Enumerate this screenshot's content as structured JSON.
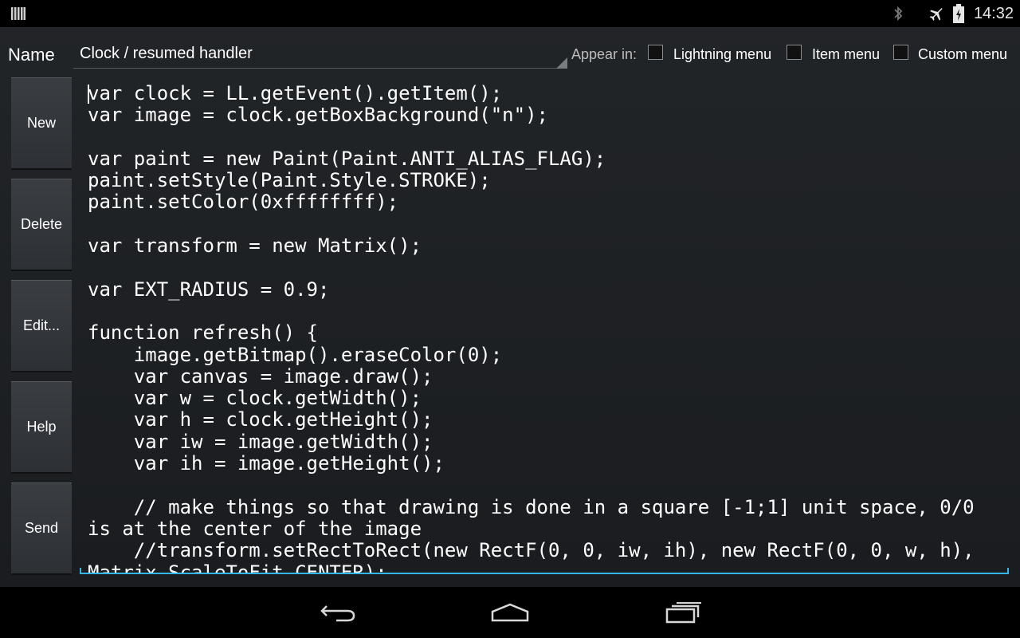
{
  "status_bar": {
    "time": "14:32",
    "icons": [
      "notification-bars-icon",
      "bluetooth-icon",
      "airplane-mode-icon",
      "battery-icon"
    ]
  },
  "header": {
    "name_label": "Name",
    "name_value": "Clock / resumed handler",
    "appear_in_label": "Appear in:",
    "checkboxes": [
      {
        "label": "Lightning menu",
        "checked": false
      },
      {
        "label": "Item menu",
        "checked": false
      },
      {
        "label": "Custom menu",
        "checked": false
      }
    ]
  },
  "side_buttons": [
    "New",
    "Delete",
    "Edit...",
    "Help",
    "Send"
  ],
  "editor": {
    "code": "var clock = LL.getEvent().getItem();\nvar image = clock.getBoxBackground(\"n\");\n\nvar paint = new Paint(Paint.ANTI_ALIAS_FLAG);\npaint.setStyle(Paint.Style.STROKE);\npaint.setColor(0xffffffff);\n\nvar transform = new Matrix();\n\nvar EXT_RADIUS = 0.9;\n\nfunction refresh() {\n    image.getBitmap().eraseColor(0);\n    var canvas = image.draw();\n    var w = clock.getWidth();\n    var h = clock.getHeight();\n    var iw = image.getWidth();\n    var ih = image.getHeight();\n\n    // make things so that drawing is done in a square [-1;1] unit space, 0/0 is at the center of the image\n    //transform.setRectToRect(new RectF(0, 0, iw, ih), new RectF(0, 0, w, h), Matrix.ScaleToFit.CENTER);",
    "accent_color": "#33b5e5"
  },
  "nav_bar": {
    "buttons": [
      "back-icon",
      "home-icon",
      "recent-apps-icon"
    ]
  }
}
